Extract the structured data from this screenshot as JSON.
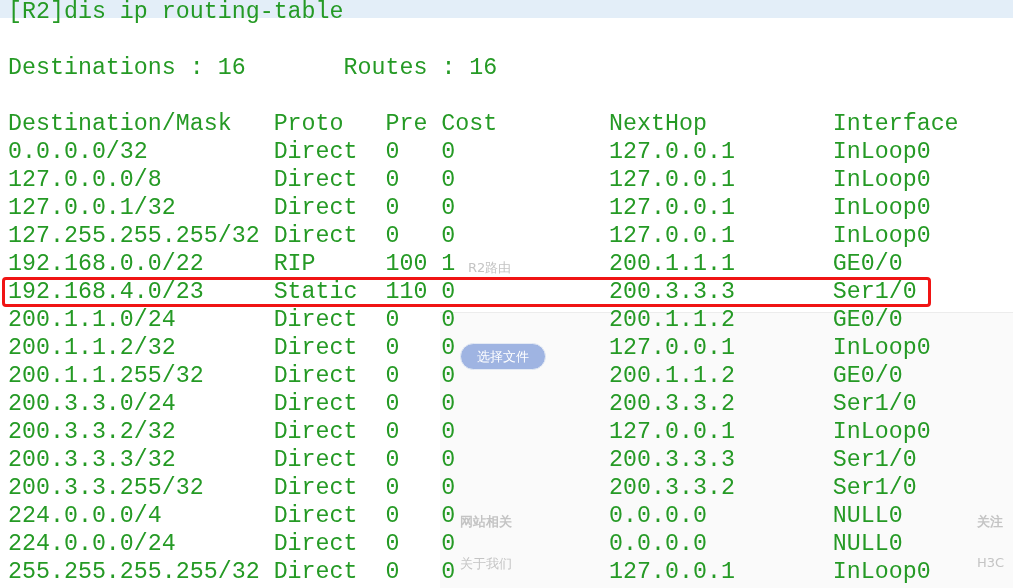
{
  "command": "[R2]dis ip routing-table",
  "summary": {
    "destinations_label": "Destinations : 16",
    "routes_label": "Routes : 16"
  },
  "table": {
    "columns": [
      "Destination/Mask",
      "Proto",
      "Pre",
      "Cost",
      "NextHop",
      "Interface"
    ],
    "rows": [
      {
        "cells": [
          "0.0.0.0/32",
          "Direct",
          "0",
          "0",
          "127.0.0.1",
          "InLoop0"
        ],
        "highlighted": false
      },
      {
        "cells": [
          "127.0.0.0/8",
          "Direct",
          "0",
          "0",
          "127.0.0.1",
          "InLoop0"
        ],
        "highlighted": false
      },
      {
        "cells": [
          "127.0.0.1/32",
          "Direct",
          "0",
          "0",
          "127.0.0.1",
          "InLoop0"
        ],
        "highlighted": false
      },
      {
        "cells": [
          "127.255.255.255/32",
          "Direct",
          "0",
          "0",
          "127.0.0.1",
          "InLoop0"
        ],
        "highlighted": false
      },
      {
        "cells": [
          "192.168.0.0/22",
          "RIP",
          "100",
          "1",
          "200.1.1.1",
          "GE0/0"
        ],
        "highlighted": false
      },
      {
        "cells": [
          "192.168.4.0/23",
          "Static",
          "110",
          "0",
          "200.3.3.3",
          "Ser1/0"
        ],
        "highlighted": true
      },
      {
        "cells": [
          "200.1.1.0/24",
          "Direct",
          "0",
          "0",
          "200.1.1.2",
          "GE0/0"
        ],
        "highlighted": false
      },
      {
        "cells": [
          "200.1.1.2/32",
          "Direct",
          "0",
          "0",
          "127.0.0.1",
          "InLoop0"
        ],
        "highlighted": false
      },
      {
        "cells": [
          "200.1.1.255/32",
          "Direct",
          "0",
          "0",
          "200.1.1.2",
          "GE0/0"
        ],
        "highlighted": false
      },
      {
        "cells": [
          "200.3.3.0/24",
          "Direct",
          "0",
          "0",
          "200.3.3.2",
          "Ser1/0"
        ],
        "highlighted": false
      },
      {
        "cells": [
          "200.3.3.2/32",
          "Direct",
          "0",
          "0",
          "127.0.0.1",
          "InLoop0"
        ],
        "highlighted": false
      },
      {
        "cells": [
          "200.3.3.3/32",
          "Direct",
          "0",
          "0",
          "200.3.3.3",
          "Ser1/0"
        ],
        "highlighted": false
      },
      {
        "cells": [
          "200.3.3.255/32",
          "Direct",
          "0",
          "0",
          "200.3.3.2",
          "Ser1/0"
        ],
        "highlighted": false
      },
      {
        "cells": [
          "224.0.0.0/4",
          "Direct",
          "0",
          "0",
          "0.0.0.0",
          "NULL0"
        ],
        "highlighted": false
      },
      {
        "cells": [
          "224.0.0.0/24",
          "Direct",
          "0",
          "0",
          "0.0.0.0",
          "NULL0"
        ],
        "highlighted": false
      },
      {
        "cells": [
          "255.255.255.255/32",
          "Direct",
          "0",
          "0",
          "127.0.0.1",
          "InLoop0"
        ],
        "highlighted": false
      }
    ]
  },
  "background_page": {
    "section_label": "R2路由",
    "file_button": "选择文件",
    "footer": [
      {
        "heading": "网站相关",
        "link": "关于我们"
      },
      {
        "heading": "关注",
        "link": "H3C"
      }
    ]
  }
}
